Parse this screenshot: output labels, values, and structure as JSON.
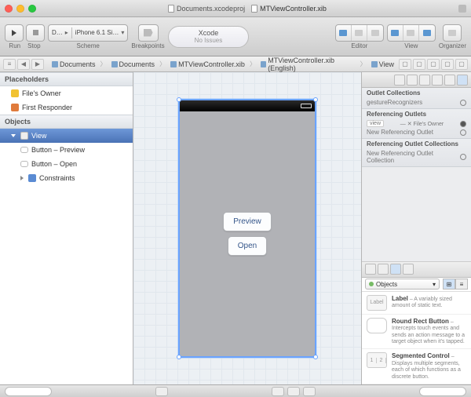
{
  "title_tabs": [
    "Documents.xcodeproj",
    "MTViewController.xib"
  ],
  "toolbar": {
    "run": "Run",
    "stop": "Stop",
    "scheme_label": "Scheme",
    "breakpoints": "Breakpoints",
    "scheme_value": "D…",
    "dest_value": "iPhone 6.1 Si…",
    "status_line1": "Xcode",
    "status_line2": "No Issues",
    "editor": "Editor",
    "view": "View",
    "organizer": "Organizer"
  },
  "jump": {
    "crumbs": [
      "Documents",
      "Documents",
      "MTViewController.xib",
      "MTViewController.xib (English)",
      "View"
    ]
  },
  "left": {
    "placeholders_hdr": "Placeholders",
    "files_owner": "File's Owner",
    "first_responder": "First Responder",
    "objects_hdr": "Objects",
    "view": "View",
    "button_preview": "Button – Preview",
    "button_open": "Button – Open",
    "constraints": "Constraints"
  },
  "canvas": {
    "btn_preview": "Preview",
    "btn_open": "Open"
  },
  "right": {
    "outlet_collections": "Outlet Collections",
    "gesture": "gestureRecognizers",
    "ref_outlets": "Referencing Outlets",
    "view": "view",
    "files_owner": "File's Owner",
    "new_ref": "New Referencing Outlet",
    "ref_out_coll": "Referencing Outlet Collections",
    "new_ref_coll": "New Referencing Outlet Collection"
  },
  "library": {
    "filter": "Objects",
    "label_name": "Label",
    "label_desc": " – A variably sized amount of static text.",
    "button_name": "Round Rect Button",
    "button_desc": " – Intercepts touch events and sends an action message to a target object when it's tapped.",
    "seg_name": "Segmented Control",
    "seg_desc": " – Displays multiple segments, each of which functions as a discrete button.",
    "thumb_label": "Label",
    "seg1": "1",
    "seg2": "2"
  }
}
